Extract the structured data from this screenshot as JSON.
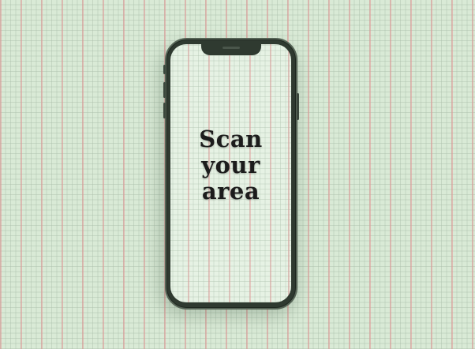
{
  "screen": {
    "headline_lines": [
      "Scan",
      "your",
      "area"
    ]
  },
  "colors": {
    "background": "#d9ead6",
    "grid_accent": "#e29696",
    "phone_frame": "#2f3a30",
    "text": "#1c1c1c"
  }
}
